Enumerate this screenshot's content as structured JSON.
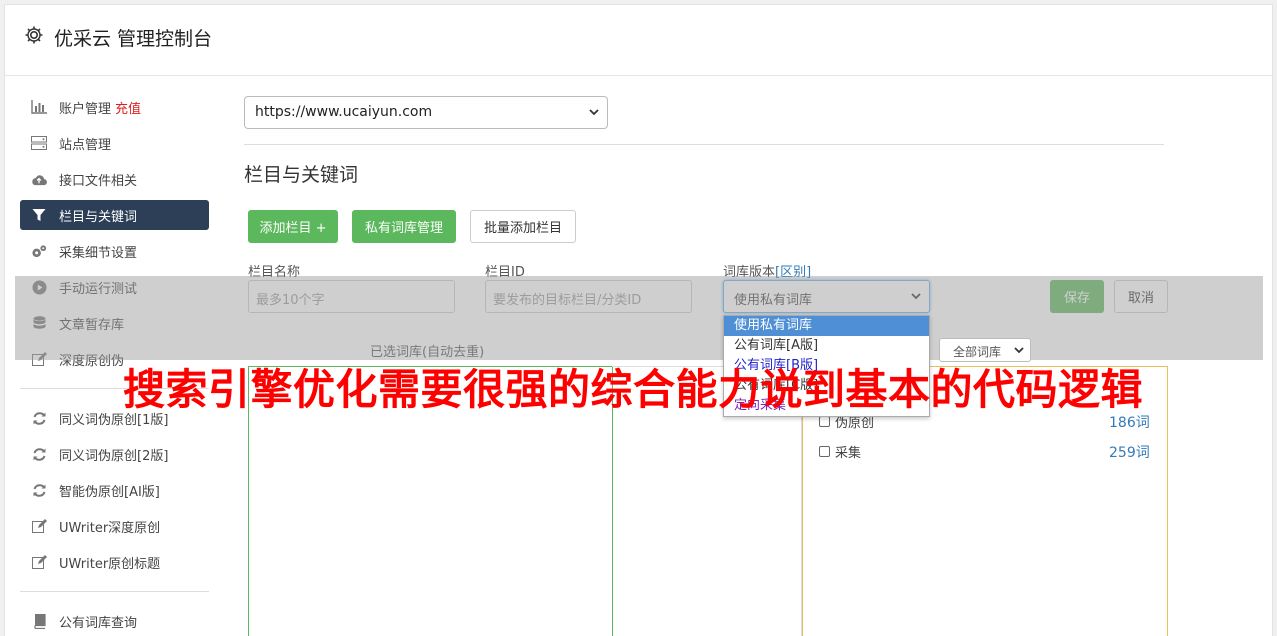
{
  "app": {
    "title": "优采云 管理控制台"
  },
  "sidebar": {
    "items": [
      {
        "icon": "bar-chart-icon",
        "label": "账户管理",
        "extra": "充值"
      },
      {
        "icon": "server-icon",
        "label": "站点管理"
      },
      {
        "icon": "cloud-upload-icon",
        "label": "接口文件相关"
      },
      {
        "icon": "filter-icon",
        "label": "栏目与关键词"
      },
      {
        "icon": "cogs-icon",
        "label": "采集细节设置"
      },
      {
        "icon": "play-circle-icon",
        "label": "手动运行测试"
      },
      {
        "icon": "database-icon",
        "label": "文章暂存库"
      },
      {
        "icon": "edit-icon",
        "label": "深度原创伪"
      }
    ],
    "items2": [
      {
        "icon": "refresh-icon",
        "label": "同义词伪原创[1版]"
      },
      {
        "icon": "refresh-icon",
        "label": "同义词伪原创[2版]"
      },
      {
        "icon": "refresh-icon",
        "label": "智能伪原创[AI版]"
      },
      {
        "icon": "edit-icon",
        "label": "UWriter深度原创"
      },
      {
        "icon": "edit-icon",
        "label": "UWriter原创标题"
      }
    ],
    "items3": [
      {
        "icon": "book-icon",
        "label": "公有词库查询"
      }
    ]
  },
  "main": {
    "site_select": "https://www.ucaiyun.com",
    "section_title": "栏目与关键词",
    "buttons": {
      "add_column": "添加栏目 +",
      "private_lib": "私有词库管理",
      "batch_add": "批量添加栏目",
      "save": "保存",
      "cancel": "取消"
    },
    "form": {
      "name_label": "栏目名称",
      "name_placeholder": "最多10个字",
      "id_label": "栏目ID",
      "id_placeholder": "要发布的目标栏目/分类ID",
      "version_label": "词库版本",
      "version_link": "[区别]",
      "version_value": "使用私有词库",
      "version_options": [
        "使用私有词库",
        "公有词库[A版]",
        "公有词库[B版]",
        "公有词库[C版]",
        "定向采集"
      ]
    },
    "selected_lib_label": "已选词库(自动去重)",
    "filter_value": "全部词库",
    "libraries": [
      {
        "name": "伪原创",
        "count": "186词"
      },
      {
        "name": "采集",
        "count": "259词"
      }
    ]
  },
  "watermark": "搜索引擎优化需要很强的综合能力说到基本的代码逻辑",
  "colors": {
    "sidebar_active": "#2d3e57",
    "green": "#5cb85c",
    "link": "#337ab7",
    "watermark": "#ff0000"
  }
}
